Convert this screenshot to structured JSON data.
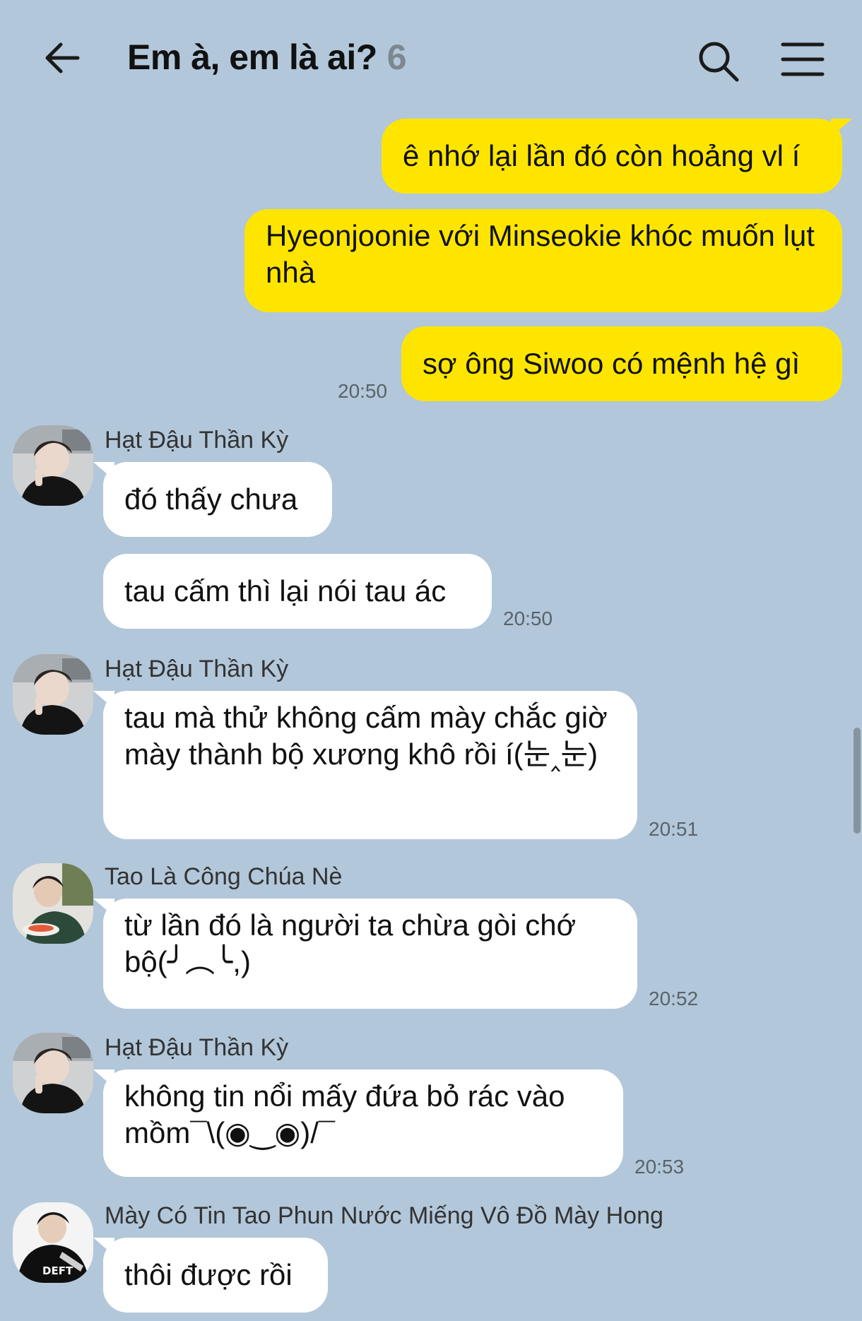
{
  "header": {
    "title": "Em à, em là ai?",
    "member_count": "6"
  },
  "messages": {
    "m1": "ê nhớ lại lần đó còn hoảng vl í",
    "m2": "Hyeonjoonie với Minseokie khóc muốn lụt nhà",
    "m3": "sợ ông Siwoo có mệnh hệ gì",
    "m3_time": "20:50",
    "g1_name": "Hạt Đậu Thần Kỳ",
    "m4": "đó thấy chưa",
    "m5": "tau cấm thì lại nói tau ác",
    "m5_time": "20:50",
    "g2_name": "Hạt Đậu Thần Kỳ",
    "m6": "tau mà thử không cấm mày chắc giờ mày thành bộ xương khô rồi í(눈‸눈)",
    "m6_time": "20:51",
    "g3_name": "Tao Là Công Chúa Nè",
    "m7": "từ lần đó là người ta chừa gòi chớ bộ(╯︵╰,)",
    "m7_time": "20:52",
    "g4_name": "Hạt Đậu Thần Kỳ",
    "m8": "không tin nổi mấy đứa bỏ rác vào mồm¯\\(◉‿◉)/¯",
    "m8_time": "20:53",
    "g5_name": "Mày Có Tin Tao Phun Nước Miếng Vô Đồ Mày Hong",
    "m9": "thôi được rồi"
  },
  "avatars": {
    "a5_text": "DEFT"
  },
  "colors": {
    "background": "#b2c7da",
    "my_bubble": "#fee500",
    "other_bubble": "#ffffff"
  }
}
